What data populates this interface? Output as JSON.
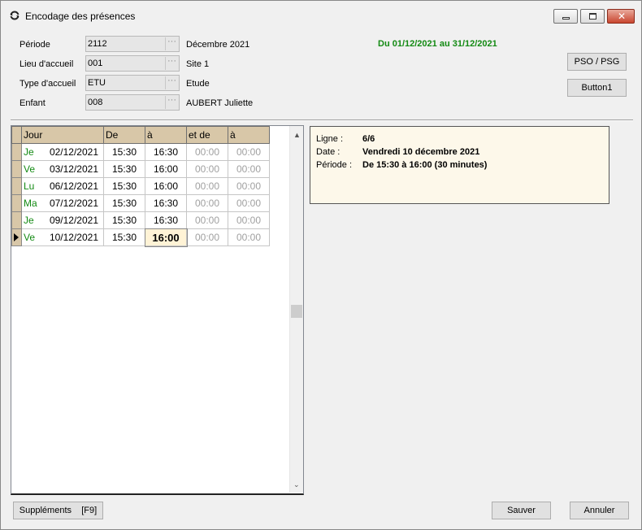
{
  "window": {
    "title": "Encodage des présences",
    "close_glyph": "✕"
  },
  "form": {
    "periode": {
      "label": "Période",
      "value": "2112",
      "desc": "Décembre 2021"
    },
    "lieu": {
      "label": "Lieu d'accueil",
      "value": "001",
      "desc": "Site 1"
    },
    "type": {
      "label": "Type d'accueil",
      "value": "ETU",
      "desc": "Etude"
    },
    "enfant": {
      "label": "Enfant",
      "value": "008",
      "desc": "AUBERT Juliette"
    },
    "lookup_glyph": "···",
    "date_range": "Du 01/12/2021 au 31/12/2021",
    "date_range_color": "#138a13"
  },
  "buttons": {
    "pso": "PSO / PSG",
    "button1": "Button1",
    "supplements": "Suppléments    [F9]",
    "sauver": "Sauver",
    "annuler": "Annuler"
  },
  "grid": {
    "columns": [
      "Jour",
      "De",
      "à",
      "et de",
      "à"
    ],
    "header_color": "#d8c7a8",
    "rows": [
      {
        "day": "Je",
        "date": "02/12/2021",
        "de": "15:30",
        "a": "16:30",
        "etde": "00:00",
        "a2": "00:00"
      },
      {
        "day": "Ve",
        "date": "03/12/2021",
        "de": "15:30",
        "a": "16:00",
        "etde": "00:00",
        "a2": "00:00"
      },
      {
        "day": "Lu",
        "date": "06/12/2021",
        "de": "15:30",
        "a": "16:00",
        "etde": "00:00",
        "a2": "00:00"
      },
      {
        "day": "Ma",
        "date": "07/12/2021",
        "de": "15:30",
        "a": "16:30",
        "etde": "00:00",
        "a2": "00:00"
      },
      {
        "day": "Je",
        "date": "09/12/2021",
        "de": "15:30",
        "a": "16:30",
        "etde": "00:00",
        "a2": "00:00"
      },
      {
        "day": "Ve",
        "date": "10/12/2021",
        "de": "15:30",
        "a": "16:00",
        "etde": "00:00",
        "a2": "00:00"
      }
    ],
    "current_row": 5,
    "current_col": "a",
    "scroll_up_glyph": "▲",
    "scroll_down_glyph": "⌄"
  },
  "info": {
    "ligne_label": "Ligne :",
    "ligne_value": "6/6",
    "date_label": "Date :",
    "date_value": "Vendredi 10 décembre 2021",
    "periode_label": "Période :",
    "periode_value": "De 15:30 à 16:00 (30 minutes)"
  }
}
